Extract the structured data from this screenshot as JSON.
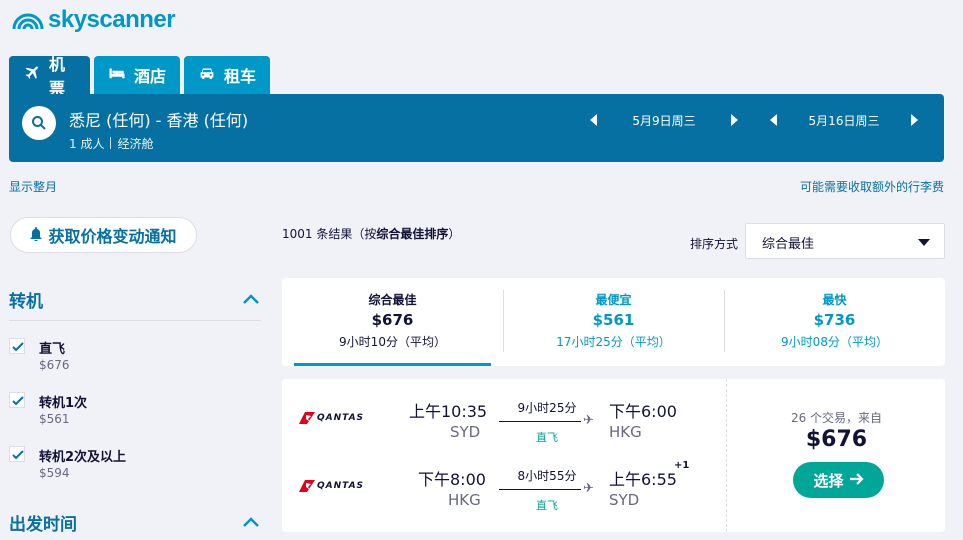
{
  "brand": {
    "name": "skyscanner",
    "color": "#0098c7"
  },
  "tabs": [
    {
      "label": "机票",
      "icon": "plane-icon",
      "active": true
    },
    {
      "label": "酒店",
      "icon": "bed-icon",
      "active": false
    },
    {
      "label": "租车",
      "icon": "car-icon",
      "active": false
    }
  ],
  "search": {
    "route": "悉尼 (任何) - 香港 (任何)",
    "passengers": "1 成人",
    "cabin": "经济舱",
    "depart_date": "5月9日周三",
    "return_date": "5月16日周三"
  },
  "links": {
    "show_month": "显示整月",
    "baggage_fees": "可能需要收取额外的行李费"
  },
  "alert_button": "获取价格变动通知",
  "filters": {
    "stops": {
      "title": "转机",
      "items": [
        {
          "label": "直飞",
          "price": "$676",
          "checked": true
        },
        {
          "label": "转机1次",
          "price": "$561",
          "checked": true
        },
        {
          "label": "转机2次及以上",
          "price": "$594",
          "checked": true
        }
      ]
    },
    "depart_time": {
      "title": "出发时间"
    }
  },
  "results": {
    "count_prefix": "1001 条结果（按",
    "count_sort": "综合最佳排序",
    "count_suffix": "）"
  },
  "sort": {
    "label": "排序方式",
    "selected": "综合最佳"
  },
  "sort_tabs": [
    {
      "title": "综合最佳",
      "price": "$676",
      "duration": "9小时10分（平均）",
      "active": true
    },
    {
      "title": "最便宜",
      "price": "$561",
      "duration": "17小时25分（平均）",
      "active": false
    },
    {
      "title": "最快",
      "price": "$736",
      "duration": "9小时08分（平均）",
      "active": false
    }
  ],
  "itinerary": {
    "airline": "QANTAS",
    "legs": [
      {
        "depart_time": "上午10:35",
        "depart_airport": "SYD",
        "duration": "9小时25分",
        "stops": "直飞",
        "arrive_time": "下午6:00",
        "arrive_airport": "HKG",
        "day_offset": ""
      },
      {
        "depart_time": "下午8:00",
        "depart_airport": "HKG",
        "duration": "8小时55分",
        "stops": "直飞",
        "arrive_time": "上午6:55",
        "arrive_airport": "SYD",
        "day_offset": "+1"
      }
    ],
    "deals": "26 个交易，来自",
    "price": "$676",
    "select_label": "选择"
  }
}
